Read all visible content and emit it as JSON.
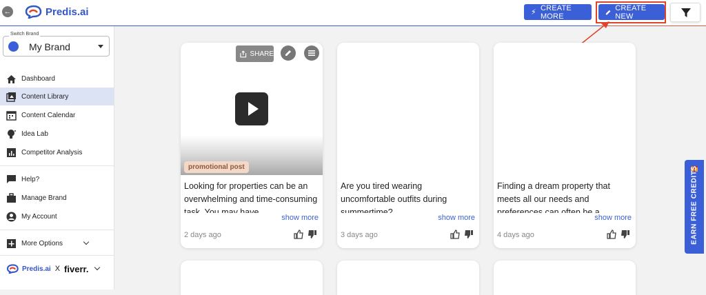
{
  "header": {
    "logo_text": "Predis.ai",
    "create_more_label": "CREATE MORE",
    "create_new_label": "CREATE NEW",
    "accent": "#3b5fd6",
    "highlight_color": "#e0432b"
  },
  "sidebar": {
    "brand_legend": "Switch Brand",
    "brand_name": "My Brand",
    "items": [
      {
        "label": "Dashboard",
        "icon": "home-icon"
      },
      {
        "label": "Content Library",
        "icon": "library-icon"
      },
      {
        "label": "Content Calendar",
        "icon": "calendar-icon"
      },
      {
        "label": "Idea Lab",
        "icon": "lightbulb-icon"
      },
      {
        "label": "Competitor Analysis",
        "icon": "analytics-icon"
      },
      {
        "label": "Help?",
        "icon": "chat-icon"
      },
      {
        "label": "Manage Brand",
        "icon": "briefcase-icon"
      },
      {
        "label": "My Account",
        "icon": "account-icon"
      },
      {
        "label": "More Options",
        "icon": "plus-box-icon"
      }
    ],
    "footer_logo": "Predis.ai",
    "footer_x": "X",
    "footer_partner": "fiverr."
  },
  "cards": [
    {
      "share_label": "SHARE",
      "tag": "promotional post",
      "text": "Looking for properties can be an overwhelming and time-consuming task. You may have",
      "show_more": "show more",
      "time": "2 days ago"
    },
    {
      "text": "Are you tired wearing uncomfortable outfits during summertime?",
      "show_more": "show more",
      "time": "3 days ago"
    },
    {
      "text": "Finding a dream property that meets all our needs and preferences can often be a",
      "show_more": "show more",
      "time": "4 days ago"
    }
  ],
  "earn_credits_label": "EARN FREE CREDITS"
}
